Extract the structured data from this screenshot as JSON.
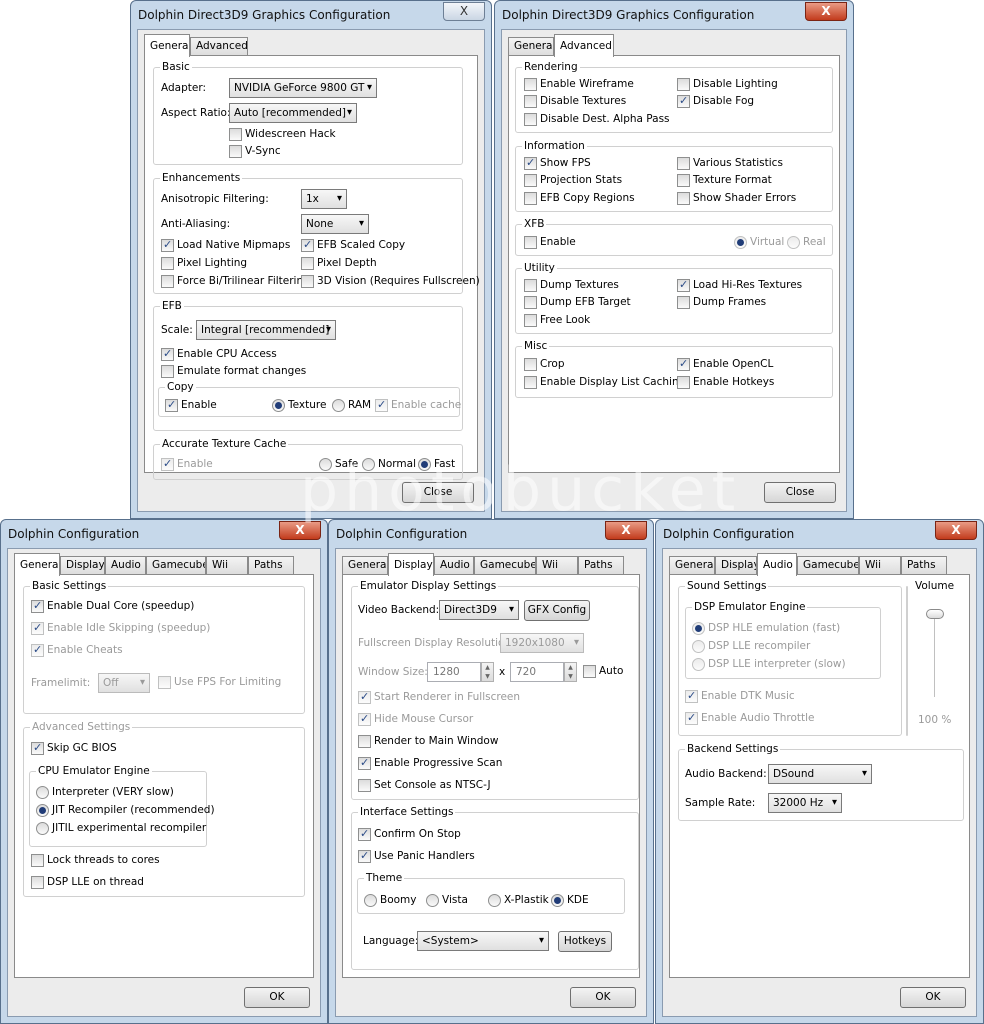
{
  "gfx_window": {
    "title": "Dolphin Direct3D9 Graphics Configuration",
    "close_x": "X",
    "tabs": [
      "General",
      "Advanced"
    ],
    "close_label": "Close"
  },
  "gfx_general": {
    "basic": {
      "title": "Basic",
      "adapter_label": "Adapter:",
      "adapter_value": "NVIDIA GeForce 9800 GT",
      "aspect_label": "Aspect Ratio:",
      "aspect_value": "Auto [recommended]",
      "widescreen_hack": "Widescreen Hack",
      "vsync": "V-Sync"
    },
    "enh": {
      "title": "Enhancements",
      "aniso_label": "Anisotropic Filtering:",
      "aniso_value": "1x",
      "aa_label": "Anti-Aliasing:",
      "aa_value": "None",
      "native_mipmaps": "Load Native Mipmaps",
      "efb_scaled_copy": "EFB Scaled Copy",
      "pixel_lighting": "Pixel Lighting",
      "pixel_depth": "Pixel Depth",
      "force_filter": "Force Bi/Trilinear Filtering",
      "vision3d": "3D Vision (Requires Fullscreen)"
    },
    "efb": {
      "title": "EFB",
      "scale_label": "Scale:",
      "scale_value": "Integral [recommended]",
      "cpu_access": "Enable CPU Access",
      "emulate_format": "Emulate format changes",
      "copy_title": "Copy",
      "copy_enable": "Enable",
      "copy_texture": "Texture",
      "copy_ram": "RAM",
      "copy_cache": "Enable cache"
    },
    "atc": {
      "title": "Accurate Texture Cache",
      "enable": "Enable",
      "safe": "Safe",
      "normal": "Normal",
      "fast": "Fast"
    }
  },
  "gfx_advanced": {
    "rendering": {
      "title": "Rendering",
      "wireframe": "Enable Wireframe",
      "disable_lighting": "Disable Lighting",
      "disable_textures": "Disable Textures",
      "disable_fog": "Disable Fog",
      "disable_alpha": "Disable Dest. Alpha Pass"
    },
    "info": {
      "title": "Information",
      "show_fps": "Show FPS",
      "various_stats": "Various Statistics",
      "projection_stats": "Projection Stats",
      "texture_format": "Texture Format",
      "efb_copy_regions": "EFB Copy Regions",
      "shader_errors": "Show Shader Errors"
    },
    "xfb": {
      "title": "XFB",
      "enable": "Enable",
      "virtual": "Virtual",
      "real": "Real"
    },
    "utility": {
      "title": "Utility",
      "dump_textures": "Dump Textures",
      "hires_textures": "Load Hi-Res Textures",
      "dump_efb": "Dump EFB Target",
      "dump_frames": "Dump Frames",
      "free_look": "Free Look"
    },
    "misc": {
      "title": "Misc",
      "crop": "Crop",
      "opencl": "Enable OpenCL",
      "dlist": "Enable Display List Caching",
      "hotkeys": "Enable Hotkeys"
    }
  },
  "cfg_window": {
    "title": "Dolphin Configuration",
    "close_x": "X",
    "tabs": [
      "General",
      "Display",
      "Audio",
      "Gamecube",
      "Wii",
      "Paths"
    ],
    "ok_label": "OK"
  },
  "cfg_general": {
    "basic_title": "Basic Settings",
    "dual_core": "Enable Dual Core (speedup)",
    "idle_skip": "Enable Idle Skipping (speedup)",
    "cheats": "Enable Cheats",
    "framelimit_label": "Framelimit:",
    "framelimit_value": "Off",
    "fps_limit": "Use FPS For Limiting",
    "adv_title": "Advanced Settings",
    "skip_bios": "Skip GC BIOS",
    "cpu_title": "CPU Emulator Engine",
    "interpreter": "Interpreter (VERY slow)",
    "jit": "JIT Recompiler (recommended)",
    "jitil": "JITIL experimental recompiler",
    "lock_threads": "Lock threads to cores",
    "dsp_thread": "DSP LLE on thread"
  },
  "cfg_display": {
    "emu_title": "Emulator Display Settings",
    "backend_label": "Video Backend:",
    "backend_value": "Direct3D9",
    "gfx_config": "GFX Config",
    "fs_res_label": "Fullscreen Display Resolution:",
    "fs_res_value": "1920x1080",
    "win_size_label": "Window Size:",
    "win_w": "1280",
    "x_label": "x",
    "win_h": "720",
    "auto": "Auto",
    "start_fs": "Start Renderer in Fullscreen",
    "hide_cursor": "Hide Mouse Cursor",
    "render_main": "Render to Main Window",
    "progressive": "Enable Progressive Scan",
    "ntsc_j": "Set Console as NTSC-J",
    "iface_title": "Interface Settings",
    "confirm_stop": "Confirm On Stop",
    "panic": "Use Panic Handlers",
    "theme_title": "Theme",
    "boomy": "Boomy",
    "vista": "Vista",
    "xplastik": "X-Plastik",
    "kde": "KDE",
    "lang_label": "Language:",
    "lang_value": "<System>",
    "hotkeys_btn": "Hotkeys"
  },
  "cfg_audio": {
    "sound_title": "Sound Settings",
    "dsp_title": "DSP Emulator Engine",
    "hle": "DSP HLE emulation (fast)",
    "lle_recomp": "DSP LLE recompiler",
    "lle_interp": "DSP LLE interpreter (slow)",
    "dtk": "Enable DTK Music",
    "throttle": "Enable Audio Throttle",
    "volume_title": "Volume",
    "volume_value": "100 %",
    "volume_level": 1.0,
    "backend_title": "Backend Settings",
    "backend_label": "Audio Backend:",
    "backend_value": "DSound",
    "rate_label": "Sample Rate:",
    "rate_value": "32000 Hz"
  },
  "watermark": "photobucket"
}
